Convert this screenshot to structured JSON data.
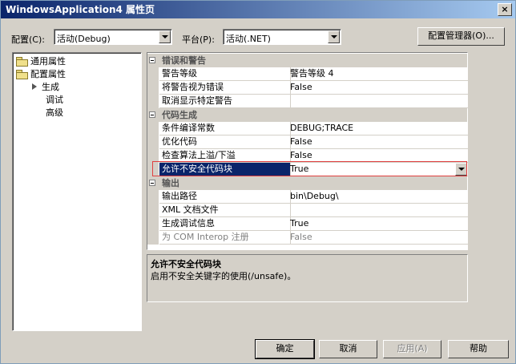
{
  "window": {
    "title": "WindowsApplication4 属性页",
    "close_label": "×"
  },
  "toolbar": {
    "config_label": "配置(C):",
    "config_value": "活动(Debug)",
    "platform_label": "平台(P):",
    "platform_value": "活动(.NET)",
    "config_manager_label": "配置管理器(O)..."
  },
  "tree": {
    "items": [
      {
        "label": "通用属性"
      },
      {
        "label": "配置属性"
      }
    ],
    "children": [
      {
        "label": "生成"
      },
      {
        "label": "调试"
      },
      {
        "label": "高级"
      }
    ]
  },
  "grid": {
    "categories": [
      {
        "label": "错误和警告"
      },
      {
        "label": "代码生成"
      },
      {
        "label": "输出"
      }
    ],
    "rows": [
      {
        "name": "警告等级",
        "value": "警告等级 4"
      },
      {
        "name": "将警告视为错误",
        "value": "False"
      },
      {
        "name": "取消显示特定警告",
        "value": ""
      },
      {
        "name": "条件编译常数",
        "value": "DEBUG;TRACE"
      },
      {
        "name": "优化代码",
        "value": "False"
      },
      {
        "name": "检查算法上溢/下溢",
        "value": "False"
      },
      {
        "name": "允许不安全代码块",
        "value": "True"
      },
      {
        "name": "输出路径",
        "value": "bin\\Debug\\"
      },
      {
        "name": "XML 文档文件",
        "value": ""
      },
      {
        "name": "生成调试信息",
        "value": "True"
      },
      {
        "name": "为 COM Interop 注册",
        "value": "False"
      }
    ]
  },
  "description": {
    "title": "允许不安全代码块",
    "text": "启用不安全关键字的使用(/unsafe)。"
  },
  "buttons": {
    "ok": "确定",
    "cancel": "取消",
    "apply": "应用(A)",
    "help": "帮助"
  }
}
